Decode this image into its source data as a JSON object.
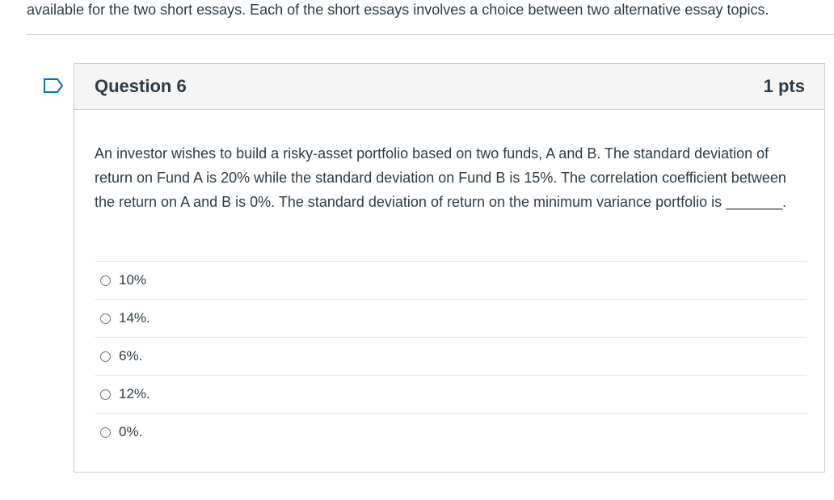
{
  "intro_text": "available for the two short essays. Each of the short essays involves a choice between two alternative essay topics.",
  "question": {
    "name": "Question 6",
    "points": "1 pts",
    "text": "An investor wishes to build a risky-asset portfolio based on two funds, A and B. The standard deviation of return on Fund A is 20% while the standard deviation on Fund B is 15%. The correlation coefficient between the return on A and B is 0%. The standard deviation of return on the minimum variance portfolio is _______.",
    "answers": [
      {
        "label": "10%",
        "selected": false
      },
      {
        "label": "14%.",
        "selected": false
      },
      {
        "label": "6%.",
        "selected": false
      },
      {
        "label": "12%.",
        "selected": false
      },
      {
        "label": "0%.",
        "selected": false
      }
    ]
  },
  "icons": {
    "flag": "bookmark-flag-icon",
    "flag_color": "#0374b5"
  }
}
